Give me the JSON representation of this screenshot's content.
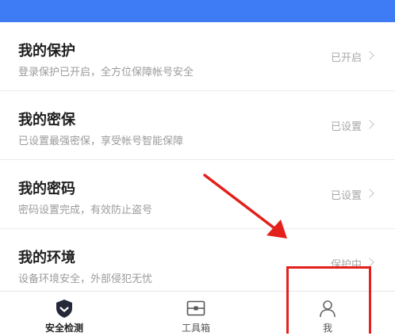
{
  "colors": {
    "header": "#3d7cf4",
    "annotation": "#e3201b"
  },
  "rows": [
    {
      "title": "我的保护",
      "desc": "登录保护已开启，全方位保障帐号安全",
      "status": "已开启"
    },
    {
      "title": "我的密保",
      "desc": "已设置最强密保，享受帐号智能保障",
      "status": "已设置"
    },
    {
      "title": "我的密码",
      "desc": "密码设置完成，有效防止盗号",
      "status": "已设置"
    },
    {
      "title": "我的环境",
      "desc": "设备环境安全，外部侵犯无忧",
      "status": "保护中"
    }
  ],
  "tabs": [
    {
      "label": "安全检测",
      "icon": "shield-icon",
      "active": true
    },
    {
      "label": "工具箱",
      "icon": "toolbox-icon",
      "active": false
    },
    {
      "label": "我",
      "icon": "person-icon",
      "active": false
    }
  ]
}
